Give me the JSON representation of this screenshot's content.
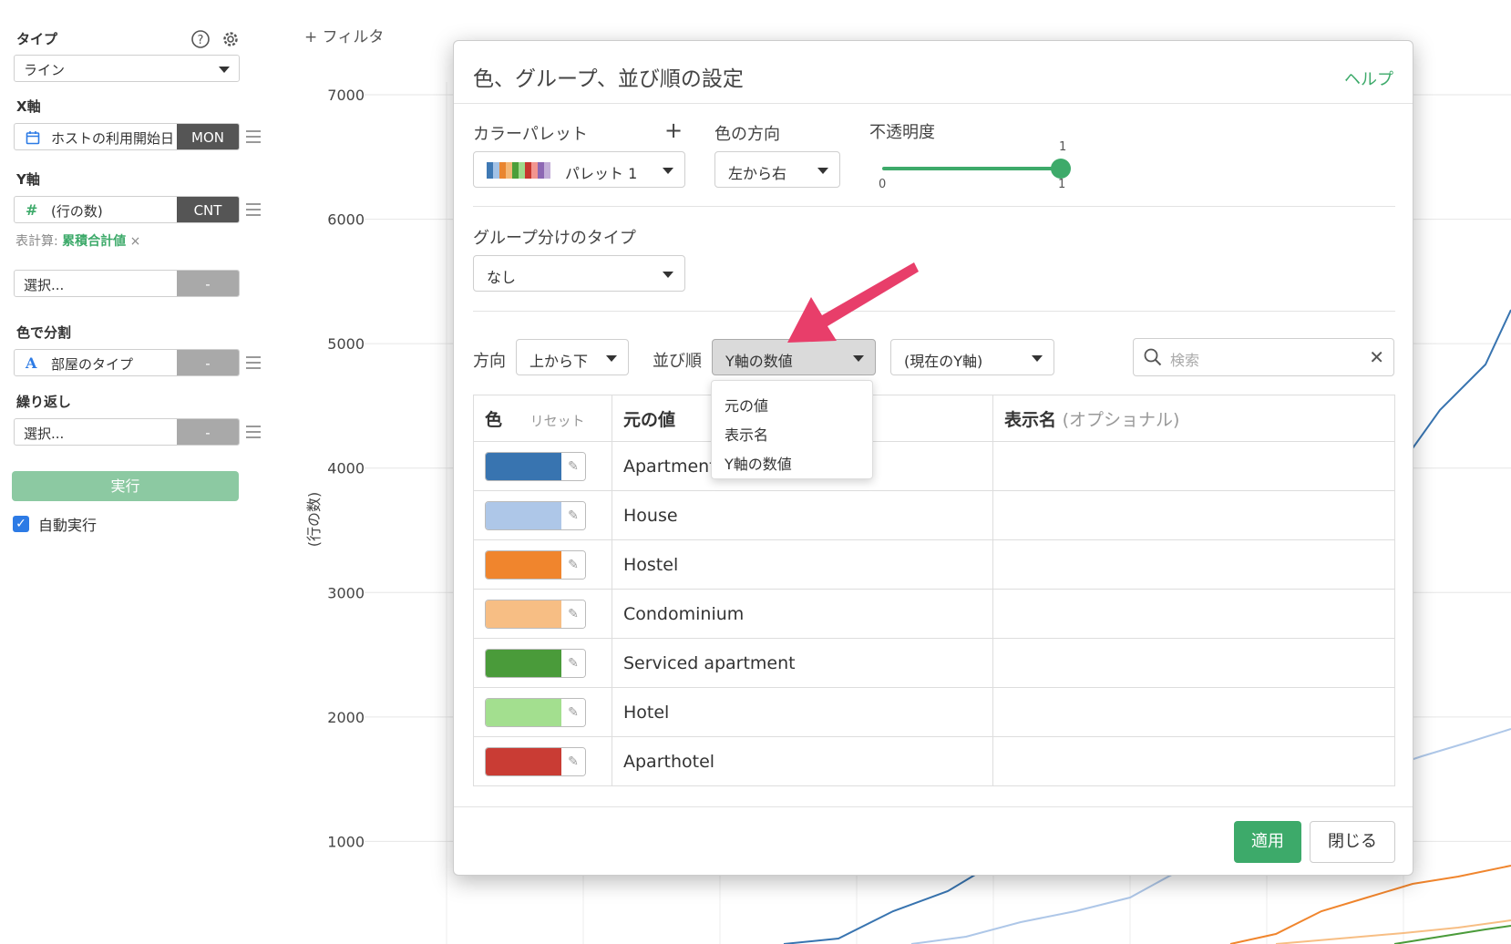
{
  "left_panel": {
    "type_label": "タイプ",
    "type_value": "ライン",
    "x_label": "X軸",
    "x_field": "ホストの利用開始日",
    "x_badge": "MON",
    "y_label": "Y軸",
    "y_field": "(行の数)",
    "y_badge": "CNT",
    "table_calc_prefix": "表計算:",
    "table_calc_value": "累積合計値",
    "table_calc_close": "×",
    "extra_select": "選択...",
    "extra_badge": "-",
    "color_split_label": "色で分割",
    "color_field": "部屋のタイプ",
    "color_badge": "-",
    "repeat_label": "繰り返し",
    "repeat_select": "選択...",
    "repeat_badge": "-",
    "run_button": "実行",
    "auto_run": "自動実行"
  },
  "chart": {
    "filter_link": "フィルタ",
    "y_axis_title": "(行の数)",
    "y_ticks": [
      "7000",
      "6000",
      "5000",
      "4000",
      "3000",
      "2000",
      "1000"
    ]
  },
  "chart_data": {
    "type": "line",
    "ylabel": "(行の数)",
    "ylim": [
      0,
      7000
    ],
    "y_ticks": [
      1000,
      2000,
      3000,
      4000,
      5000,
      6000,
      7000
    ]
  },
  "modal": {
    "title": "色、グループ、並び順の設定",
    "help": "ヘルプ",
    "palette_label": "カラーパレット",
    "palette_add": "+",
    "palette_value": "パレット 1",
    "palette_colors": [
      "#3f79b4",
      "#a3c2e6",
      "#e9852f",
      "#f3b776",
      "#4b9e3a",
      "#9fd98b",
      "#c7372e",
      "#f2958f",
      "#8d67b3",
      "#c3aed8",
      "#8c5a4c",
      "#c49b91",
      "#d77ac4",
      "#f2b4de",
      "#7f7f7f",
      "#c9c9c9",
      "#bcbd2c",
      "#dbdb8d"
    ],
    "direction_label": "色の方向",
    "direction_value": "左から右",
    "opacity_label": "不透明度",
    "opacity_value": "1",
    "opacity_min": "0",
    "opacity_max": "1",
    "opacity_level": 1.0,
    "group_type_label": "グループ分けのタイプ",
    "group_type_value": "なし",
    "order_dir_label": "方向",
    "order_dir_value": "上から下",
    "sort_label": "並び順",
    "sort_value": "Y軸の数値",
    "sort_secondary": "(現在のY軸)",
    "search_placeholder": "検索",
    "sort_options": [
      "元の値",
      "表示名",
      "Y軸の数値"
    ],
    "table": {
      "col_color": "色",
      "col_reset": "リセット",
      "col_original": "元の値",
      "col_display": "表示名",
      "col_display_opt": "(オプショナル)",
      "rows": [
        {
          "color": "#3874b0",
          "value": "Apartment",
          "display": ""
        },
        {
          "color": "#aec7e8",
          "value": "House",
          "display": ""
        },
        {
          "color": "#f0852d",
          "value": "Hostel",
          "display": ""
        },
        {
          "color": "#f7be84",
          "value": "Condominium",
          "display": ""
        },
        {
          "color": "#4a9b3a",
          "value": "Serviced apartment",
          "display": ""
        },
        {
          "color": "#a3df8f",
          "value": "Hotel",
          "display": ""
        },
        {
          "color": "#c93c34",
          "value": "Aparthotel",
          "display": ""
        }
      ]
    },
    "apply_button": "適用",
    "close_button": "閉じる"
  }
}
